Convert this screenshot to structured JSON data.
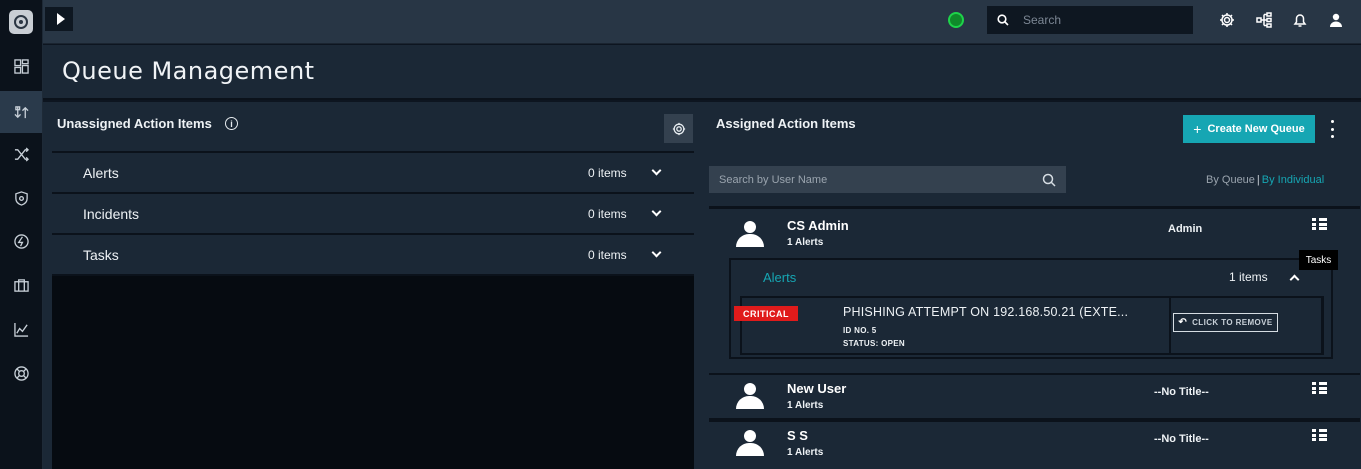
{
  "topbar": {
    "search_placeholder": "Search",
    "icons": [
      "play-icon",
      "status-icon",
      "search-icon",
      "gear-icon",
      "hierarchy-icon",
      "bell-icon",
      "user-icon"
    ]
  },
  "sidebar": {
    "items": [
      {
        "name": "dashboard-icon"
      },
      {
        "name": "queue-icon",
        "active": true
      },
      {
        "name": "shuffle-icon"
      },
      {
        "name": "shield-icon"
      },
      {
        "name": "lightning-icon"
      },
      {
        "name": "briefcase-icon"
      },
      {
        "name": "chart-icon"
      },
      {
        "name": "lifebuoy-icon"
      }
    ]
  },
  "page": {
    "title": "Queue Management"
  },
  "unassigned": {
    "heading": "Unassigned Action Items",
    "info_glyph": "i",
    "rows": [
      {
        "label": "Alerts",
        "count": "0 items"
      },
      {
        "label": "Incidents",
        "count": "0 items"
      },
      {
        "label": "Tasks",
        "count": "0 items"
      }
    ]
  },
  "assigned": {
    "heading": "Assigned Action Items",
    "create_plus": "+",
    "create_label": "Create New Queue",
    "user_search_placeholder": "Search by User Name",
    "view_by_queue": "By Queue",
    "view_separator": "|",
    "view_by_individual": "By Individual",
    "users": [
      {
        "name": "CS Admin",
        "alerts": "1 Alerts",
        "role": "Admin",
        "expanded": {
          "label": "Alerts",
          "count": "1 items",
          "item": {
            "badge": "CRITICAL",
            "title": "PHISHING ATTEMPT ON 192.168.50.21 (EXTE...",
            "id": "ID NO. 5",
            "status": "STATUS: OPEN",
            "remove_icon": "↶",
            "remove_label": "CLICK TO REMOVE",
            "more_glyph": "."
          }
        }
      },
      {
        "name": "New User",
        "alerts": "1 Alerts",
        "role": "--No Title--"
      },
      {
        "name": "S S",
        "alerts": "1 Alerts",
        "role": "--No Title--"
      }
    ],
    "tooltip": "Tasks"
  },
  "colors": {
    "accent": "#16a6b3",
    "critical": "#e01b1b",
    "panel": "#1b2836",
    "topbar": "#283645",
    "online": "#1ed34a"
  }
}
